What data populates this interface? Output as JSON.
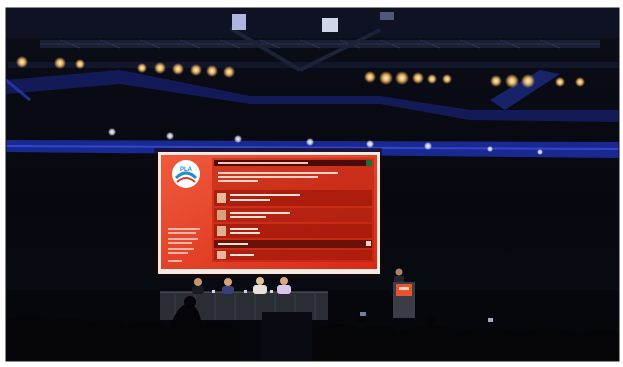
{
  "scene": {
    "kind": "photograph",
    "subject": "conference-hall-stage"
  },
  "slide": {
    "logo_text": "PLA",
    "slide_text_legible": false
  },
  "colors": {
    "hall_dark": "#07080f",
    "truss_blue": "#1d2fa8",
    "screen_red": "#e23a22",
    "screen_dark_red": "#7a1409",
    "spotlight_warm": "#ffc46a",
    "podium_orange": "#e8532c"
  }
}
